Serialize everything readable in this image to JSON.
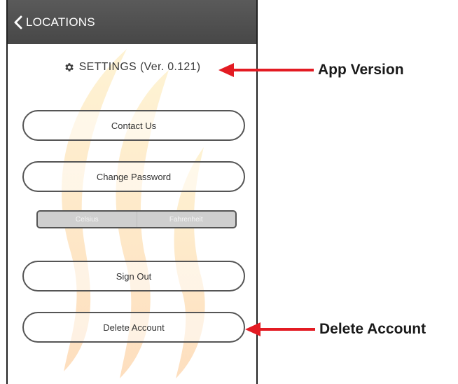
{
  "topbar": {
    "back_label": "LOCATIONS"
  },
  "settings": {
    "title": "SETTINGS",
    "version": "(Ver. 0.121)"
  },
  "buttons": {
    "contact_us": "Contact Us",
    "change_password": "Change Password",
    "sign_out": "Sign Out",
    "delete_account": "Delete Account"
  },
  "temperature_units": {
    "options": [
      "Celsius",
      "Fahrenheit"
    ]
  },
  "annotations": {
    "app_version": "App Version",
    "delete_account": "Delete Account"
  },
  "colors": {
    "topbar": "#4f4f4f",
    "arrow": "#e31b23",
    "flame_yellow": "#fde68a",
    "flame_orange": "#fdc9a0"
  },
  "icons": {
    "back": "chevron-left-icon",
    "settings": "gear-icon"
  }
}
